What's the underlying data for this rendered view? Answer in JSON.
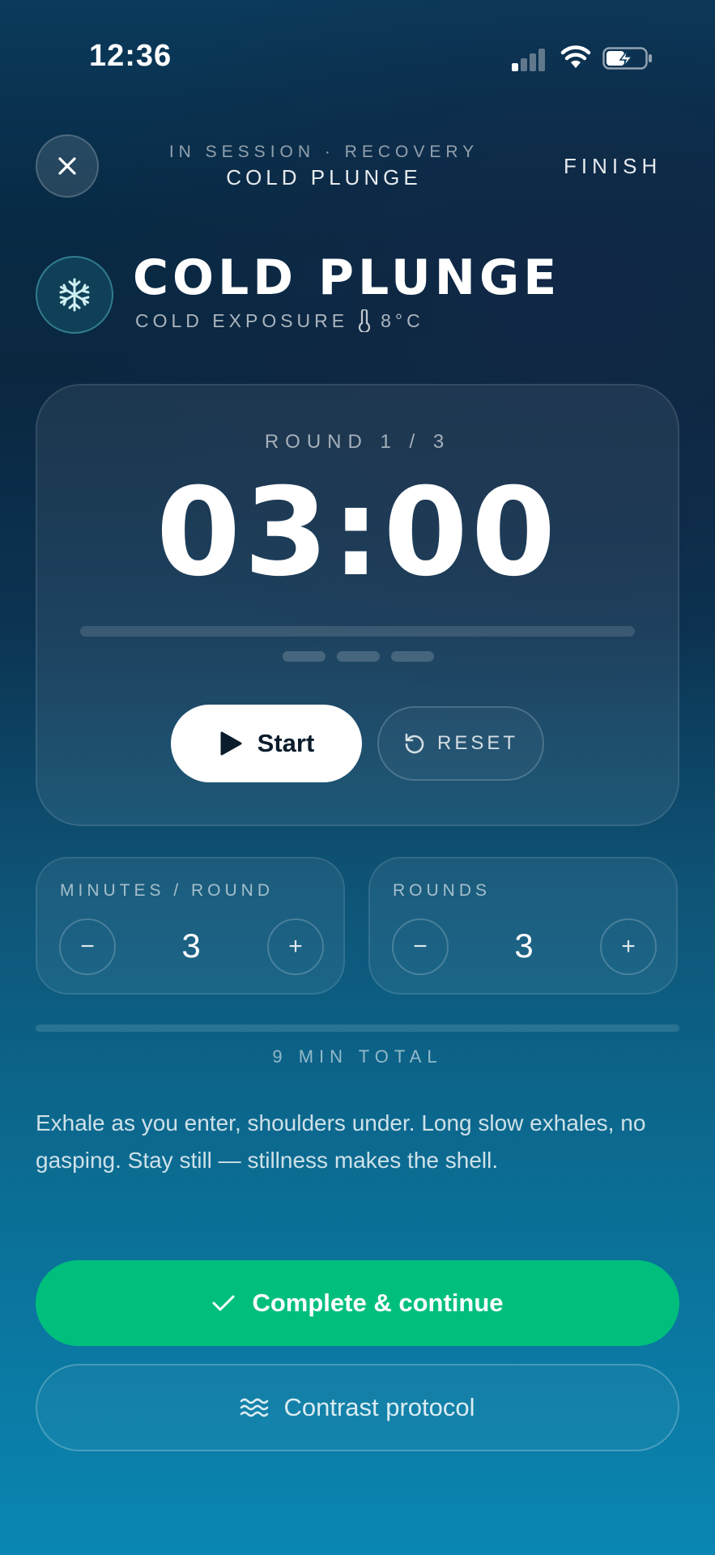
{
  "status_bar": {
    "time": "12:36",
    "icons": [
      "cellular-signal-icon",
      "wifi-icon",
      "battery-charging-icon"
    ]
  },
  "header": {
    "close_icon": "close-icon",
    "subtitle": "IN SESSION · RECOVERY",
    "title": "COLD PLUNGE",
    "finish_label": "FINISH"
  },
  "session": {
    "icon": "snowflake-icon",
    "title": "COLD PLUNGE",
    "category": "COLD EXPOSURE",
    "temperature_icon": "thermometer-icon",
    "temperature": "8°C"
  },
  "timer": {
    "round_label": "ROUND 1 / 3",
    "time": "03:00",
    "progress": 0,
    "round_dots": 3,
    "start_label": "Start",
    "reset_label": "RESET"
  },
  "settings": {
    "minutes": {
      "label": "MINUTES / ROUND",
      "value": "3",
      "minus": "−",
      "plus": "+"
    },
    "rounds": {
      "label": "ROUNDS",
      "value": "3",
      "minus": "−",
      "plus": "+"
    }
  },
  "total": {
    "label": "9 MIN TOTAL"
  },
  "tip": "Exhale as you enter, shoulders under. Long slow exhales, no gasping. Stay still — stillness makes the shell.",
  "actions": {
    "complete_label": "Complete & continue",
    "contrast_label": "Contrast protocol"
  },
  "colors": {
    "accent_green": "#00bf7d",
    "ice_teal": "#5ac8d2"
  }
}
